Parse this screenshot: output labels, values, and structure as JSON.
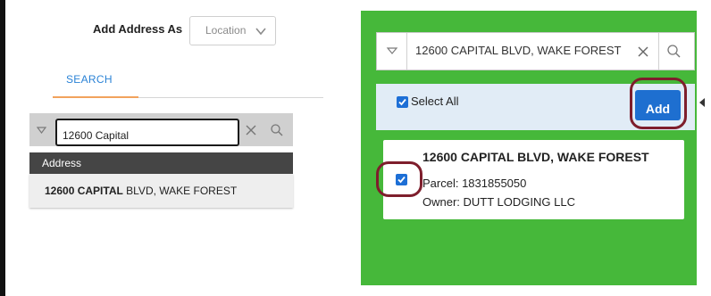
{
  "left_panel": {
    "add_address_as_label": "Add Address As",
    "type_select": {
      "selected": "Location",
      "icon": "chevron-down-icon"
    },
    "tab": {
      "label": "SEARCH"
    },
    "search": {
      "value": "12600 Capital",
      "dropdown_icon": "triangle-down-icon",
      "clear_icon": "close-icon",
      "search_icon": "search-icon"
    },
    "suggestions": {
      "header": "Address",
      "items": [
        {
          "match": "12600 CAPITAL",
          "rest": " BLVD, WAKE FOREST"
        }
      ]
    }
  },
  "right_panel": {
    "search": {
      "value": "12600 CAPITAL BLVD, WAKE FOREST",
      "dropdown_icon": "triangle-down-icon",
      "clear_icon": "close-icon",
      "search_icon": "search-icon"
    },
    "select_all": {
      "label": "Select All",
      "checked": true
    },
    "add_button": {
      "label": "Add"
    },
    "result": {
      "title": "12600 CAPITAL BLVD, WAKE FOREST",
      "parcel": "Parcel: 1831855050",
      "owner": "Owner: DUTT LODGING LLC",
      "checked": true
    }
  },
  "colors": {
    "panel_green": "#46b83a",
    "primary_blue": "#1e6fd0",
    "highlight_ring": "#7e1e2c",
    "tab_underline": "#f2a25c"
  }
}
